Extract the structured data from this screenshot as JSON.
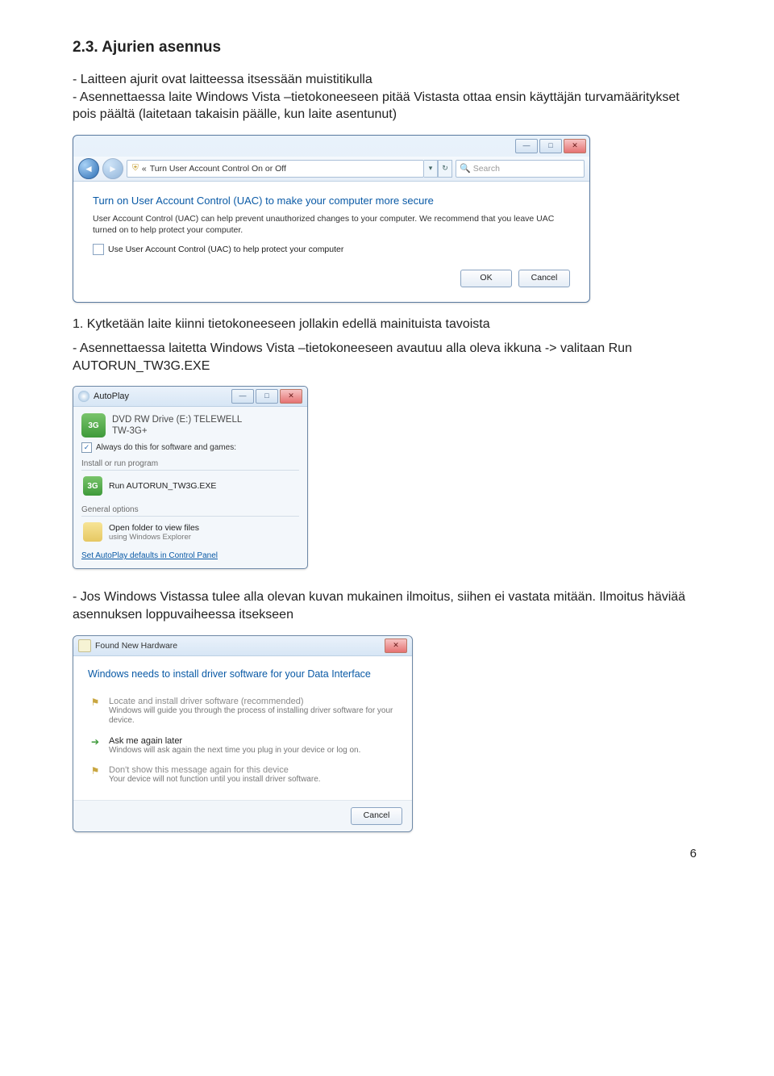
{
  "section": {
    "title": "2.3. Ajurien asennus",
    "intro": "- Laitteen ajurit ovat laitteessa itsessään muistitikulla\n- Asennettaessa laite Windows Vista –tietokoneeseen pitää Vistasta ottaa ensin käyttäjän turvamääritykset pois päältä (laitetaan takaisin päälle, kun laite asentunut)",
    "step1": "1. Kytketään laite kiinni tietokoneeseen jollakin edellä mainituista tavoista",
    "note1": "- Asennettaessa laitetta Windows Vista –tietokoneeseen avautuu alla oleva ikkuna -> valitaan Run AUTORUN_TW3G.EXE",
    "note2": "- Jos Windows Vistassa tulee alla olevan kuvan mukainen ilmoitus, siihen ei vastata mitään. Ilmoitus häviää asennuksen loppuvaiheessa itsekseen"
  },
  "uac": {
    "breadcrumb_prefix": "«",
    "breadcrumb": "Turn User Account Control On or Off",
    "search_placeholder": "Search",
    "heading": "Turn on User Account Control (UAC) to make your computer more secure",
    "desc": "User Account Control (UAC) can help prevent unauthorized changes to your computer. We recommend that you leave UAC turned on to help protect your computer.",
    "checkbox_label": "Use User Account Control (UAC) to help protect your computer",
    "ok": "OK",
    "cancel": "Cancel",
    "min": "—",
    "max": "□",
    "close": "✕"
  },
  "autoplay": {
    "title": "AutoPlay",
    "drive_line1": "DVD RW Drive (E:) TELEWELL",
    "drive_line2": "TW-3G+",
    "always": "Always do this for software and games:",
    "section_install": "Install or run program",
    "run_label": "Run AUTORUN_TW3G.EXE",
    "section_general": "General options",
    "open_folder": "Open folder to view files",
    "open_folder_sub": "using Windows Explorer",
    "defaults_link": "Set AutoPlay defaults in Control Panel",
    "icon3g": "3G",
    "min": "—",
    "max": "□",
    "close": "✕",
    "check": "✓"
  },
  "fnh": {
    "title": "Found New Hardware",
    "heading": "Windows needs to install driver software for your Data Interface",
    "opt1_title": "Locate and install driver software (recommended)",
    "opt1_sub": "Windows will guide you through the process of installing driver software for your device.",
    "opt2_title": "Ask me again later",
    "opt2_sub": "Windows will ask again the next time you plug in your device or log on.",
    "opt3_title": "Don't show this message again for this device",
    "opt3_sub": "Your device will not function until you install driver software.",
    "cancel": "Cancel",
    "close": "✕",
    "arrow": "➔",
    "shield": "⚑"
  },
  "page_number": "6"
}
